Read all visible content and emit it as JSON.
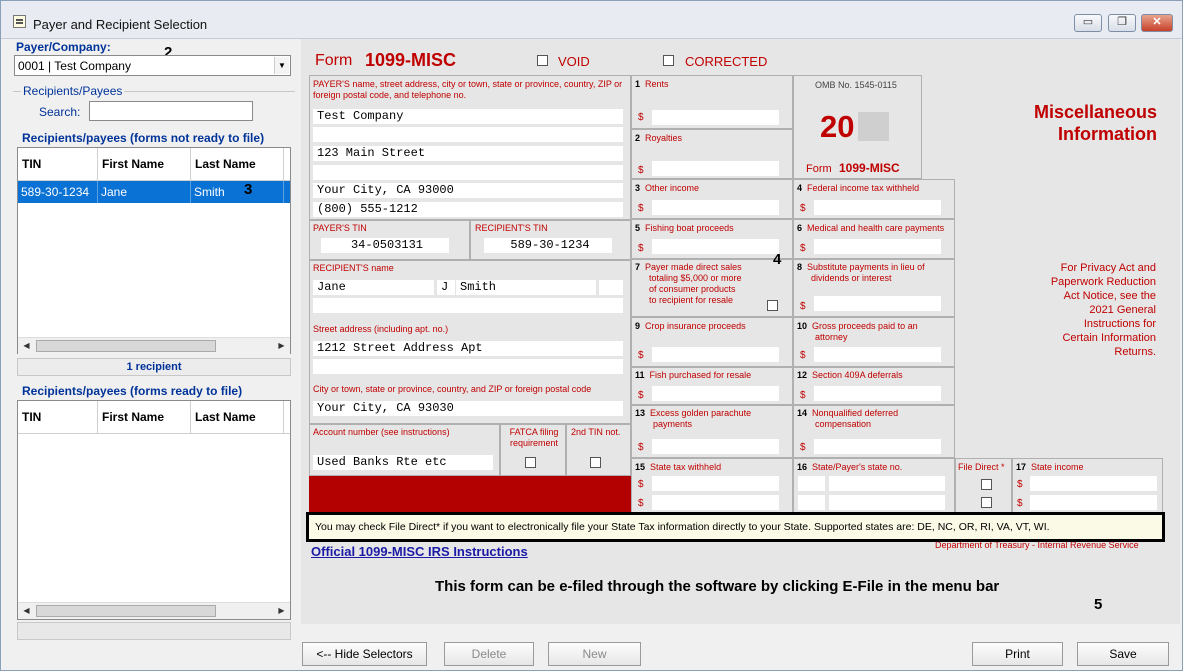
{
  "window": {
    "title": "Payer and Recipient Selection",
    "minimize": "▭",
    "restore": "❐",
    "close": "✕"
  },
  "left": {
    "payer_label": "Payer/Company:",
    "payer_value": "0001 | Test Company",
    "recipients_group": "Recipients/Payees",
    "search_label": "Search:",
    "search_value": "",
    "not_ready_header": "Recipients/payees (forms not ready to file)",
    "columns": [
      "TIN",
      "First Name",
      "Last Name"
    ],
    "not_ready_rows": [
      {
        "tin": "589-30-1234",
        "first": "Jane",
        "last": "Smith"
      }
    ],
    "recipient_count": "1 recipient",
    "ready_header": "Recipients/payees (forms ready to file)"
  },
  "form": {
    "form_word": "Form",
    "form_name": "1099-MISC",
    "void": "VOID",
    "corrected": "CORRECTED",
    "payer_cap": "PAYER'S name, street address, city or town, state or province, country, ZIP or foreign postal code, and telephone no.",
    "payer_lines": [
      "Test Company",
      "",
      "123 Main Street",
      "",
      "Your City, CA 93000",
      "(800) 555-1212"
    ],
    "omb": "OMB No. 1545-0115",
    "year": "20",
    "form_label": "Form",
    "form_label_name": "1099-MISC",
    "misc_title": "Miscellaneous Information",
    "payer_tin_cap": "PAYER'S TIN",
    "payer_tin": "34-0503131",
    "recipient_tin_cap": "RECIPIENT'S TIN",
    "recipient_tin": "589-30-1234",
    "recipient_name_cap": "RECIPIENT'S name",
    "recipient_first": "Jane",
    "recipient_mi": "J",
    "recipient_last": "Smith",
    "street_cap": "Street address  (including apt. no.)",
    "street": "1212 Street Address Apt",
    "city_cap": "City or town, state or province, country, and ZIP or foreign postal code",
    "city": "Your City, CA 93030",
    "account_cap": "Account number (see instructions)",
    "account": "Used Banks Rte etc",
    "fatca_cap": "FATCA filing requirement",
    "second_tin_cap": "2nd TIN not.",
    "boxes": {
      "b1": "Rents",
      "b2": "Royalties",
      "b3": "Other income",
      "b4": "Federal income tax withheld",
      "b5": "Fishing boat proceeds",
      "b6": "Medical and health care payments",
      "b7": "Payer made direct sales totaling $5,000 or more of consumer products to recipient for resale",
      "b8": "Substitute payments in lieu of dividends or interest",
      "b9": "Crop insurance proceeds",
      "b10": "Gross proceeds paid to an attorney",
      "b11": "Fish purchased for resale",
      "b12": "Section 409A deferrals",
      "b13": "Excess golden parachute payments",
      "b14": "Nonqualified deferred compensation",
      "b15": "State tax withheld",
      "b16": "State/Payer's state no.",
      "file_direct": "File Direct *",
      "b17": "State income"
    },
    "privacy": "For Privacy Act and Paperwork Reduction Act Notice, see the 2021 General Instructions for Certain Information Returns.",
    "dept": "Department of Treasury - Internal Revenue Service",
    "notice": "You may check File Direct* if you want to electronically file your State Tax information directly to your State.  Supported states are:  DE, NC, OR, RI, VA, VT, WI.",
    "irs_link": "Official 1099-MISC  IRS Instructions",
    "efile_note": "This form can be e-filed through the software by clicking E-File in the menu bar",
    "dollar": "$"
  },
  "buttons": {
    "hide": "<-- Hide Selectors",
    "delete": "Delete",
    "new": "New",
    "print": "Print",
    "save": "Save"
  },
  "annotations": {
    "a2": "2",
    "a3": "3",
    "a4": "4",
    "a5": "5"
  }
}
